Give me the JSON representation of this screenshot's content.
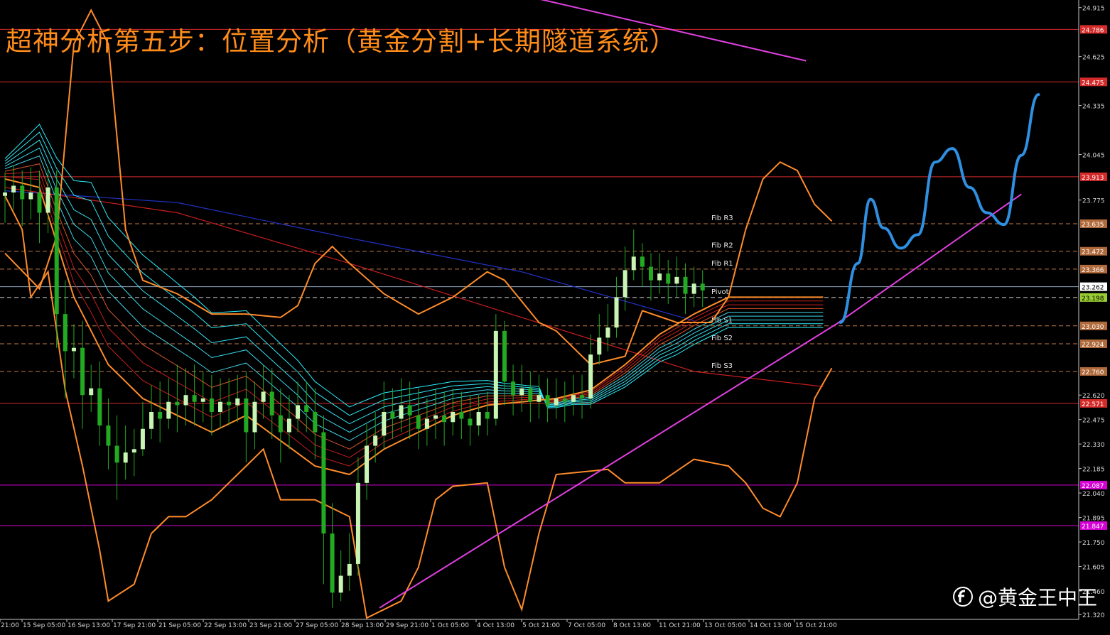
{
  "chart_data": {
    "type": "candlestick",
    "title": "超神分析第五步：位置分析（黄金分割+长期隧道系统）",
    "ylim": [
      21.3,
      24.96
    ],
    "y_ticks": [
      "24.915",
      "24.625",
      "24.335",
      "24.045",
      "23.775",
      "22.620",
      "22.475",
      "22.330",
      "22.185",
      "22.040",
      "21.895",
      "21.750",
      "21.605",
      "21.460",
      "21.320"
    ],
    "x_ticks": [
      "21:00",
      "15 Sep 05:00",
      "16 Sep 13:00",
      "17 Sep 21:00",
      "21 Sep 05:00",
      "22 Sep 13:00",
      "23 Sep 21:00",
      "27 Sep 05:00",
      "28 Sep 13:00",
      "29 Sep 21:00",
      "1 Oct 05:00",
      "4 Oct 13:00",
      "5 Oct 21:00",
      "7 Oct 05:00",
      "8 Oct 13:00",
      "11 Oct 21:00",
      "13 Oct 05:00",
      "14 Oct 13:00",
      "15 Oct 21:00"
    ],
    "price_levels": [
      {
        "value": 24.786,
        "label": "24.786",
        "color": "#d42a2a"
      },
      {
        "value": 24.475,
        "label": "24.475",
        "color": "#d42a2a"
      },
      {
        "value": 23.913,
        "label": "23.913",
        "color": "#d42a2a"
      },
      {
        "value": 22.571,
        "label": "22.571",
        "color": "#d42a2a"
      },
      {
        "value": 22.087,
        "label": "22.087",
        "color": "#d400d4"
      },
      {
        "value": 21.847,
        "label": "21.847",
        "color": "#d400d4"
      }
    ],
    "fib_levels": [
      {
        "name": "Fib R3",
        "value": 23.635
      },
      {
        "name": "Fib R2",
        "value": 23.472
      },
      {
        "name": "Fib R1",
        "value": 23.366
      },
      {
        "name": "Pivot",
        "value": 23.198
      },
      {
        "name": "Fib S1",
        "value": 23.03
      },
      {
        "name": "Fib S2",
        "value": 22.924
      },
      {
        "name": "Fib S3",
        "value": 22.76
      }
    ],
    "current_price": "23.262",
    "fib_color": "#c27a4a",
    "pivot_color": "#9acd32",
    "up_color": "#c8f5b4",
    "down_color": "#22aa22",
    "bollinger_color": "#ff8c2a",
    "trendline_color": "#e040e0",
    "forecast_color": "#2f8fe0",
    "ma_long": [
      {
        "name": "blue",
        "color": "#2233cc",
        "points": [
          [
            0,
            23.83
          ],
          [
            20,
            23.76
          ],
          [
            40,
            23.55
          ],
          [
            60,
            23.35
          ],
          [
            80,
            23.06
          ]
        ]
      },
      {
        "name": "red",
        "color": "#c81e1e",
        "points": [
          [
            0,
            23.85
          ],
          [
            20,
            23.7
          ],
          [
            40,
            23.4
          ],
          [
            60,
            23.08
          ],
          [
            80,
            22.76
          ],
          [
            95,
            22.67
          ]
        ]
      }
    ],
    "bollinger": {
      "upper": [
        [
          0,
          23.46
        ],
        [
          4,
          23.25
        ],
        [
          6,
          23.56
        ],
        [
          8,
          24.7
        ],
        [
          10,
          24.9
        ],
        [
          12,
          24.7
        ],
        [
          14,
          23.6
        ],
        [
          16,
          23.3
        ],
        [
          20,
          23.22
        ],
        [
          24,
          23.1
        ],
        [
          28,
          23.1
        ],
        [
          32,
          23.08
        ],
        [
          34,
          23.15
        ],
        [
          36,
          23.4
        ],
        [
          38,
          23.5
        ],
        [
          40,
          23.4
        ],
        [
          44,
          23.22
        ],
        [
          48,
          23.1
        ],
        [
          52,
          23.2
        ],
        [
          56,
          23.35
        ],
        [
          58,
          23.3
        ],
        [
          62,
          23.05
        ],
        [
          64,
          23.0
        ],
        [
          68,
          22.8
        ],
        [
          72,
          22.85
        ],
        [
          74,
          23.12
        ],
        [
          78,
          23.05
        ],
        [
          82,
          23.05
        ],
        [
          84,
          23.2
        ],
        [
          86,
          23.6
        ],
        [
          88,
          23.9
        ],
        [
          90,
          24.0
        ],
        [
          92,
          23.95
        ],
        [
          94,
          23.75
        ],
        [
          96,
          23.65
        ]
      ],
      "lower": [
        [
          0,
          23.8
        ],
        [
          2,
          23.6
        ],
        [
          3,
          23.2
        ],
        [
          5,
          23.35
        ],
        [
          7,
          22.65
        ],
        [
          9,
          22.2
        ],
        [
          11,
          21.7
        ],
        [
          12,
          21.4
        ],
        [
          15,
          21.5
        ],
        [
          17,
          21.8
        ],
        [
          19,
          21.9
        ],
        [
          21,
          21.9
        ],
        [
          24,
          22.0
        ],
        [
          26,
          22.1
        ],
        [
          28,
          22.2
        ],
        [
          30,
          22.3
        ],
        [
          32,
          22.0
        ],
        [
          36,
          22.0
        ],
        [
          40,
          21.9
        ],
        [
          42,
          21.3
        ],
        [
          46,
          21.4
        ],
        [
          48,
          21.6
        ],
        [
          50,
          22.0
        ],
        [
          52,
          22.08
        ],
        [
          56,
          22.1
        ],
        [
          58,
          21.6
        ],
        [
          60,
          21.35
        ],
        [
          62,
          21.8
        ],
        [
          64,
          22.15
        ],
        [
          70,
          22.18
        ],
        [
          72,
          22.1
        ],
        [
          76,
          22.1
        ],
        [
          80,
          22.24
        ],
        [
          84,
          22.2
        ],
        [
          86,
          22.1
        ],
        [
          88,
          21.95
        ],
        [
          90,
          21.9
        ],
        [
          92,
          22.1
        ],
        [
          94,
          22.6
        ],
        [
          96,
          22.78
        ]
      ]
    },
    "ribbon": {
      "count": 9,
      "base": [
        [
          0,
          23.9
        ],
        [
          4,
          23.85
        ],
        [
          8,
          23.2
        ],
        [
          12,
          22.8
        ],
        [
          16,
          22.6
        ],
        [
          20,
          22.5
        ],
        [
          24,
          22.4
        ],
        [
          28,
          22.5
        ],
        [
          32,
          22.35
        ],
        [
          36,
          22.2
        ],
        [
          40,
          22.15
        ],
        [
          44,
          22.3
        ],
        [
          48,
          22.4
        ],
        [
          52,
          22.5
        ],
        [
          56,
          22.56
        ],
        [
          60,
          22.58
        ],
        [
          64,
          22.6
        ],
        [
          68,
          22.65
        ],
        [
          72,
          22.8
        ],
        [
          76,
          22.98
        ],
        [
          80,
          23.1
        ],
        [
          84,
          23.2
        ]
      ],
      "spread": [
        [
          0,
          0.12
        ],
        [
          6,
          0.5
        ],
        [
          10,
          0.88
        ],
        [
          16,
          0.85
        ],
        [
          22,
          0.75
        ],
        [
          28,
          0.62
        ],
        [
          34,
          0.55
        ],
        [
          40,
          0.4
        ],
        [
          46,
          0.3
        ],
        [
          52,
          0.2
        ],
        [
          58,
          0.12
        ],
        [
          62,
          0.08
        ],
        [
          66,
          0.1
        ],
        [
          72,
          0.22
        ],
        [
          78,
          0.3
        ],
        [
          84,
          0.3
        ]
      ]
    },
    "trendlines": [
      {
        "points": [
          [
            43.5,
            21.36
          ],
          [
            96.5,
            23.04
          ]
        ]
      },
      {
        "points": [
          [
            96.5,
            23.04
          ],
          [
            118,
            23.81
          ]
        ]
      },
      {
        "points": [
          [
            60,
            24.99
          ],
          [
            93,
            24.6
          ]
        ]
      }
    ],
    "forecast": [
      [
        97,
        23.05
      ],
      [
        99,
        23.4
      ],
      [
        100.5,
        23.78
      ],
      [
        102,
        23.61
      ],
      [
        104,
        23.49
      ],
      [
        106,
        23.57
      ],
      [
        108,
        24.0
      ],
      [
        110,
        24.08
      ],
      [
        112,
        23.85
      ],
      [
        114,
        23.7
      ],
      [
        116,
        23.63
      ],
      [
        118,
        24.04
      ],
      [
        120,
        24.4
      ]
    ],
    "candles": [
      [
        23.8,
        23.82,
        23.94,
        23.64
      ],
      [
        23.82,
        23.86,
        23.98,
        23.72
      ],
      [
        23.86,
        23.78,
        23.95,
        23.62
      ],
      [
        23.78,
        23.82,
        23.97,
        23.66
      ],
      [
        23.82,
        23.7,
        23.95,
        23.52
      ],
      [
        23.7,
        23.85,
        23.97,
        23.58
      ],
      [
        23.85,
        23.1,
        23.95,
        22.9
      ],
      [
        23.1,
        22.88,
        23.3,
        22.6
      ],
      [
        22.88,
        22.9,
        23.04,
        22.72
      ],
      [
        22.9,
        22.62,
        23.06,
        22.42
      ],
      [
        22.62,
        22.66,
        22.8,
        22.52
      ],
      [
        22.66,
        22.44,
        22.82,
        22.32
      ],
      [
        22.44,
        22.32,
        22.6,
        22.18
      ],
      [
        22.32,
        22.22,
        22.5,
        22.0
      ],
      [
        22.22,
        22.28,
        22.44,
        22.12
      ],
      [
        22.28,
        22.3,
        22.42,
        22.14
      ],
      [
        22.3,
        22.42,
        22.58,
        22.26
      ],
      [
        22.42,
        22.52,
        22.68,
        22.36
      ],
      [
        22.52,
        22.48,
        22.7,
        22.34
      ],
      [
        22.48,
        22.58,
        22.72,
        22.42
      ],
      [
        22.58,
        22.56,
        22.8,
        22.4
      ],
      [
        22.56,
        22.62,
        22.78,
        22.44
      ],
      [
        22.62,
        22.58,
        22.8,
        22.44
      ],
      [
        22.58,
        22.6,
        22.76,
        22.46
      ],
      [
        22.6,
        22.52,
        22.74,
        22.38
      ],
      [
        22.52,
        22.58,
        22.72,
        22.42
      ],
      [
        22.58,
        22.56,
        22.72,
        22.44
      ],
      [
        22.56,
        22.6,
        22.74,
        22.46
      ],
      [
        22.6,
        22.4,
        22.76,
        22.22
      ],
      [
        22.4,
        22.58,
        22.7,
        22.3
      ],
      [
        22.58,
        22.64,
        22.8,
        22.48
      ],
      [
        22.64,
        22.5,
        22.78,
        22.36
      ],
      [
        22.5,
        22.4,
        22.66,
        22.22
      ],
      [
        22.4,
        22.48,
        22.62,
        22.3
      ],
      [
        22.48,
        22.56,
        22.7,
        22.4
      ],
      [
        22.56,
        22.52,
        22.7,
        22.4
      ],
      [
        22.52,
        22.4,
        22.66,
        22.24
      ],
      [
        22.4,
        21.8,
        22.5,
        21.5
      ],
      [
        21.8,
        21.45,
        21.98,
        21.36
      ],
      [
        21.45,
        21.55,
        21.7,
        21.4
      ],
      [
        21.55,
        21.62,
        21.8,
        21.46
      ],
      [
        21.62,
        22.1,
        22.25,
        21.55
      ],
      [
        22.1,
        22.32,
        22.45,
        22.0
      ],
      [
        22.32,
        22.38,
        22.52,
        22.22
      ],
      [
        22.38,
        22.52,
        22.7,
        22.3
      ],
      [
        22.52,
        22.48,
        22.66,
        22.36
      ],
      [
        22.48,
        22.56,
        22.72,
        22.4
      ],
      [
        22.56,
        22.5,
        22.7,
        22.36
      ],
      [
        22.5,
        22.42,
        22.66,
        22.3
      ],
      [
        22.42,
        22.48,
        22.6,
        22.32
      ],
      [
        22.48,
        22.5,
        22.66,
        22.36
      ],
      [
        22.5,
        22.46,
        22.64,
        22.32
      ],
      [
        22.46,
        22.52,
        22.66,
        22.38
      ],
      [
        22.52,
        22.48,
        22.64,
        22.36
      ],
      [
        22.48,
        22.44,
        22.62,
        22.32
      ],
      [
        22.44,
        22.52,
        22.62,
        22.38
      ],
      [
        22.52,
        22.48,
        22.64,
        22.38
      ],
      [
        22.48,
        23.0,
        23.1,
        22.44
      ],
      [
        23.0,
        22.7,
        23.06,
        22.56
      ],
      [
        22.7,
        22.62,
        22.8,
        22.5
      ],
      [
        22.62,
        22.66,
        22.8,
        22.52
      ],
      [
        22.66,
        22.58,
        22.76,
        22.46
      ],
      [
        22.58,
        22.62,
        22.74,
        22.48
      ],
      [
        22.62,
        22.56,
        22.72,
        22.46
      ],
      [
        22.56,
        22.6,
        22.72,
        22.48
      ],
      [
        22.6,
        22.58,
        22.7,
        22.46
      ],
      [
        22.58,
        22.62,
        22.74,
        22.5
      ],
      [
        22.62,
        22.6,
        22.74,
        22.48
      ],
      [
        22.6,
        22.86,
        22.98,
        22.54
      ],
      [
        22.86,
        22.96,
        23.1,
        22.8
      ],
      [
        22.96,
        23.02,
        23.16,
        22.88
      ],
      [
        23.02,
        23.2,
        23.32,
        22.96
      ],
      [
        23.2,
        23.36,
        23.5,
        23.12
      ],
      [
        23.36,
        23.44,
        23.6,
        23.3
      ],
      [
        23.44,
        23.38,
        23.52,
        23.26
      ],
      [
        23.38,
        23.3,
        23.46,
        23.18
      ],
      [
        23.3,
        23.34,
        23.46,
        23.22
      ],
      [
        23.34,
        23.28,
        23.42,
        23.16
      ],
      [
        23.28,
        23.32,
        23.44,
        23.2
      ],
      [
        23.32,
        23.22,
        23.4,
        23.1
      ],
      [
        23.22,
        23.28,
        23.38,
        23.14
      ],
      [
        23.28,
        23.24,
        23.36,
        23.14
      ]
    ]
  }
}
